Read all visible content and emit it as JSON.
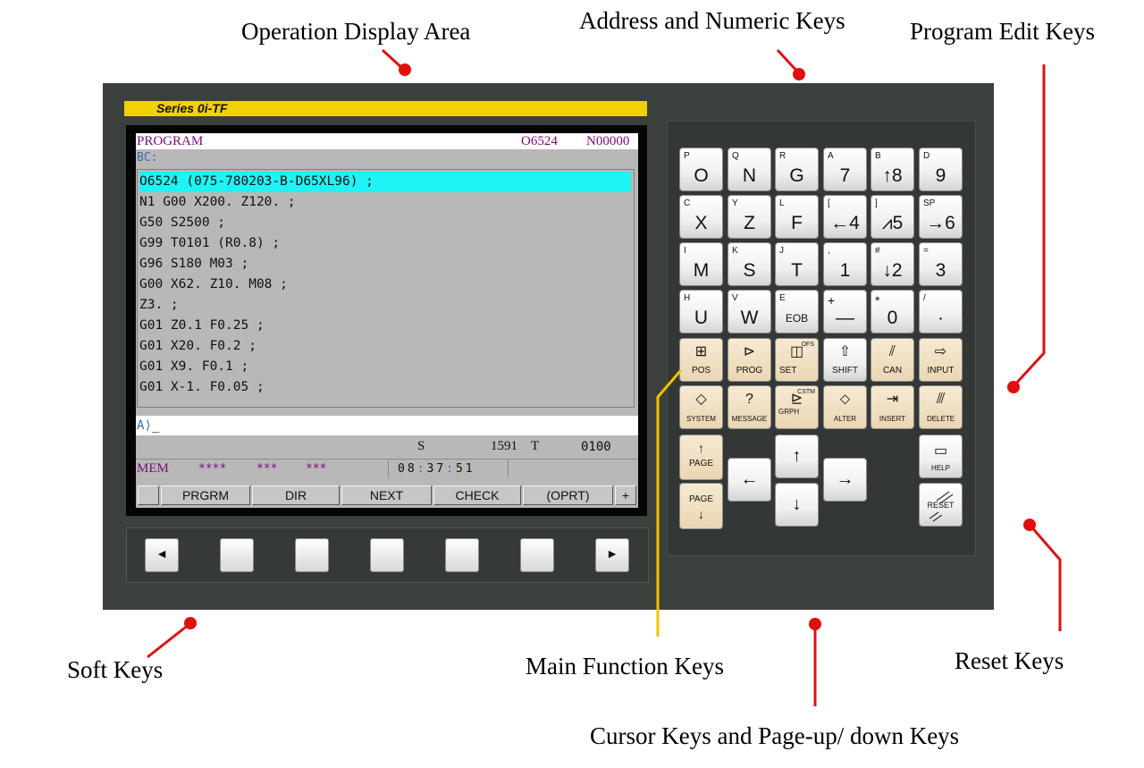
{
  "callouts": {
    "operation_display_area": "Operation Display Area",
    "address_numeric_keys": "Address and Numeric Keys",
    "program_edit_keys": "Program Edit Keys",
    "soft_keys": "Soft Keys",
    "main_function_keys": "Main Function Keys",
    "reset_keys": "Reset Keys",
    "cursor_page_keys": "Cursor Keys and Page-up/ down Keys"
  },
  "colors": {
    "panel": "#3c403d",
    "leader_red": "#e01010",
    "leader_yellow": "#f2c200",
    "highlight": "#1ff3f3"
  },
  "series_label": "Series 0i-TF",
  "screen": {
    "title": "PROGRAM",
    "program_number": "O6524",
    "sequence_number": "N00000",
    "bc_label": "BC:",
    "program_lines": [
      "O6524 (075-780203-B-D65XL96) ;",
      "N1 G00 X200. Z120. ;",
      "G50 S2500 ;",
      "G99 T0101 (R0.8) ;",
      "G96 S180 M03 ;",
      "G00 X62. Z10. M08 ;",
      "Z3. ;",
      "G01 Z0.1 F0.25 ;",
      "G01 X20. F0.2 ;",
      "G01 X9. F0.1 ;",
      "G01 X-1. F0.05 ;"
    ],
    "input_prompt": "A⟩",
    "input_cursor": "_",
    "s_label": "S",
    "s_value": "1591",
    "t_label": "T",
    "t_value": "0100",
    "mode": "MEM",
    "status_1": "****",
    "status_2": "***",
    "status_3": "***",
    "clock_h": "08",
    "clock_m": "37",
    "clock_s": "51",
    "clock_sep": ":",
    "softkey_labels": [
      "PRGRM",
      "DIR",
      "NEXT",
      "CHECK",
      "(OPRT)"
    ],
    "softkey_more": "+"
  },
  "soft_keys": {
    "left": "◄",
    "right": "►"
  },
  "keypad": {
    "address_keys": [
      {
        "sub": "P",
        "main": "O"
      },
      {
        "sub": "Q",
        "main": "N"
      },
      {
        "sub": "R",
        "main": "G"
      },
      {
        "sub": "A",
        "main": "7"
      },
      {
        "sub": "B",
        "main": "↑8"
      },
      {
        "sub": "D",
        "main": "9"
      },
      {
        "sub": "C",
        "main": "X"
      },
      {
        "sub": "Y",
        "main": "Z"
      },
      {
        "sub": "L",
        "main": "F"
      },
      {
        "sub": "[",
        "main": "←4"
      },
      {
        "sub": "]",
        "main": "⩘5"
      },
      {
        "sub": "SP",
        "main": "→6"
      },
      {
        "sub": "I",
        "main": "M"
      },
      {
        "sub": "K",
        "main": "S"
      },
      {
        "sub": "J",
        "main": "T"
      },
      {
        "sub": ",",
        "main": "1"
      },
      {
        "sub": "#",
        "main": "↓2"
      },
      {
        "sub": "=",
        "main": "3"
      },
      {
        "sub": "H",
        "main": "U"
      },
      {
        "sub": "V",
        "main": "W"
      },
      {
        "sub": "E",
        "main": "EOB"
      },
      {
        "sub": "+",
        "main": "—"
      },
      {
        "sub": "*",
        "main": "0"
      },
      {
        "sub": "/",
        "main": "·"
      }
    ],
    "function_keys": [
      {
        "icon": "⊞",
        "label": "POS"
      },
      {
        "icon": "⊳",
        "label": "PROG"
      },
      {
        "icon": "◫",
        "label": "SET",
        "sup": "OFS"
      },
      {
        "icon": "⇧",
        "label": "SHIFT"
      },
      {
        "icon": "⫽",
        "label": "CAN"
      },
      {
        "icon": "⇨",
        "label": "INPUT"
      },
      {
        "icon": "◇",
        "label": "SYSTEM"
      },
      {
        "icon": "?",
        "label": "MESSAGE"
      },
      {
        "icon": "⊵",
        "label": "GRPH",
        "sup": "CSTM"
      },
      {
        "icon": "⬦",
        "label": "ALTER"
      },
      {
        "icon": "⇥",
        "label": "INSERT"
      },
      {
        "icon": "⫻",
        "label": "DELETE"
      }
    ],
    "page_up": {
      "arrow": "↑",
      "label": "PAGE"
    },
    "page_down": {
      "arrow": "↓",
      "label": "PAGE"
    },
    "cursor": {
      "up": "↑",
      "down": "↓",
      "left": "←",
      "right": "→"
    },
    "help": {
      "icon": "▭",
      "label": "HELP"
    },
    "reset": {
      "label": "RESET"
    }
  }
}
